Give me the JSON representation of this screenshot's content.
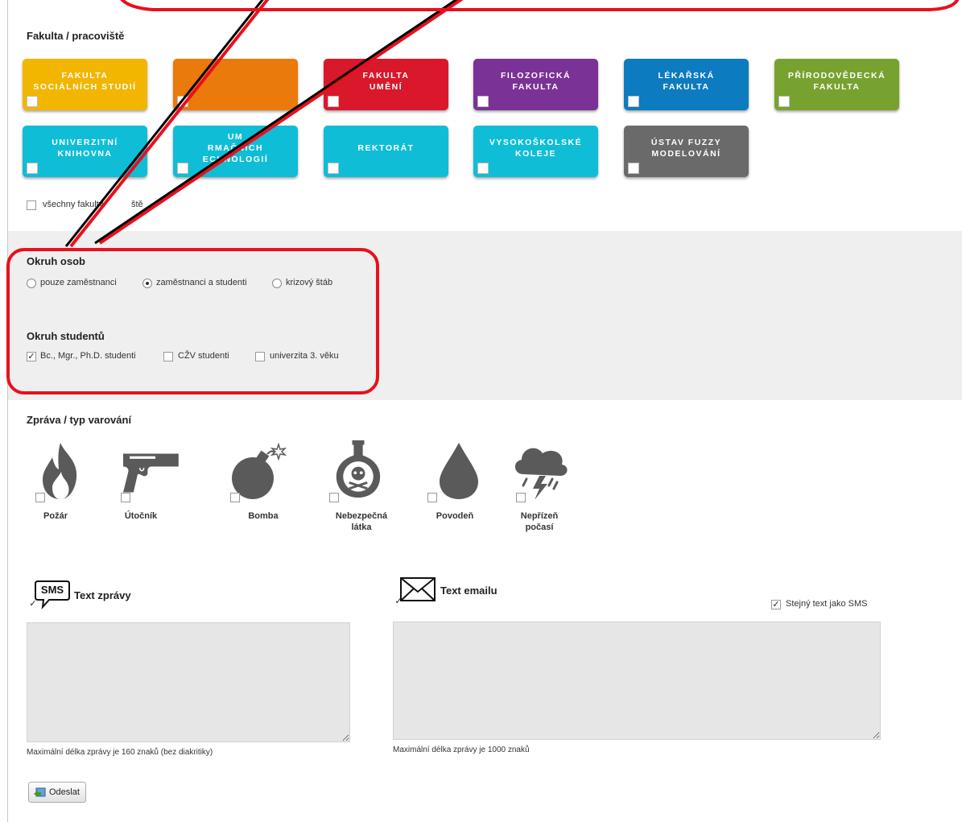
{
  "faculty": {
    "heading": "Fakulta / pracoviště",
    "tiles": [
      {
        "label": "FAKULTA\nSOCIÁLNÍCH STUDIÍ",
        "color": "#f2b500"
      },
      {
        "label": "",
        "color": "#ea7a0c"
      },
      {
        "label": "FAKULTA\nUMĚNÍ",
        "color": "#d9182b"
      },
      {
        "label": "FILOZOFICKÁ\nFAKULTA",
        "color": "#7b3296"
      },
      {
        "label": "LÉKAŘSKÁ\nFAKULTA",
        "color": "#0d7bbf"
      },
      {
        "label": "PŘÍRODOVĚDECKÁ\nFAKULTA",
        "color": "#78a22f"
      },
      {
        "label": "UNIVERZITNÍ\nKNIHOVNA",
        "color": "#10bdd6"
      },
      {
        "label": "UM\nRMAČNÍCH\nECHNOLOGIÍ",
        "color": "#10bdd6"
      },
      {
        "label": "REKTORÁT",
        "color": "#10bdd6"
      },
      {
        "label": "VYSOKOŠKOLSKÉ\nKOLEJE",
        "color": "#10bdd6"
      },
      {
        "label": "ÚSTAV FUZZY\nMODELOVÁNÍ",
        "color": "#6a6a6a"
      }
    ],
    "all_label": "všechny fakulty",
    "all_label_suffix": "ště"
  },
  "persons": {
    "heading": "Okruh osob",
    "options": [
      {
        "label": "pouze zaměstnanci",
        "selected": false
      },
      {
        "label": "zaměstnanci a studenti",
        "selected": true
      },
      {
        "label": "krizový štáb",
        "selected": false
      }
    ]
  },
  "students": {
    "heading": "Okruh studentů",
    "options": [
      {
        "label": "Bc., Mgr., Ph.D. studenti",
        "checked": true
      },
      {
        "label": "CŽV studenti",
        "checked": false
      },
      {
        "label": "univerzita 3. věku",
        "checked": false
      }
    ]
  },
  "warning": {
    "heading": "Zpráva / typ varování",
    "types": [
      {
        "label": "Požár",
        "icon": "fire-icon"
      },
      {
        "label": "Útočník",
        "icon": "gun-icon"
      },
      {
        "label": "Bomba",
        "icon": "bomb-icon"
      },
      {
        "label": "Nebezpečná\nlátka",
        "icon": "poison-icon"
      },
      {
        "label": "Povodeň",
        "icon": "drop-icon"
      },
      {
        "label": "Nepřízeň\npočasí",
        "icon": "storm-icon"
      }
    ]
  },
  "sms": {
    "icon_text": "SMS",
    "title": "Text zprávy",
    "hint": "Maximální délka zprávy je 160 znaků (bez diakritiky)"
  },
  "email": {
    "title": "Text emailu",
    "same_label": "Stejný text jako SMS",
    "hint": "Maximální délka zprávy je 1000 znaků"
  },
  "submit_label": "Odeslat",
  "colors": {
    "callout": "#e8101c",
    "icon_gray": "#5a5a5a"
  }
}
